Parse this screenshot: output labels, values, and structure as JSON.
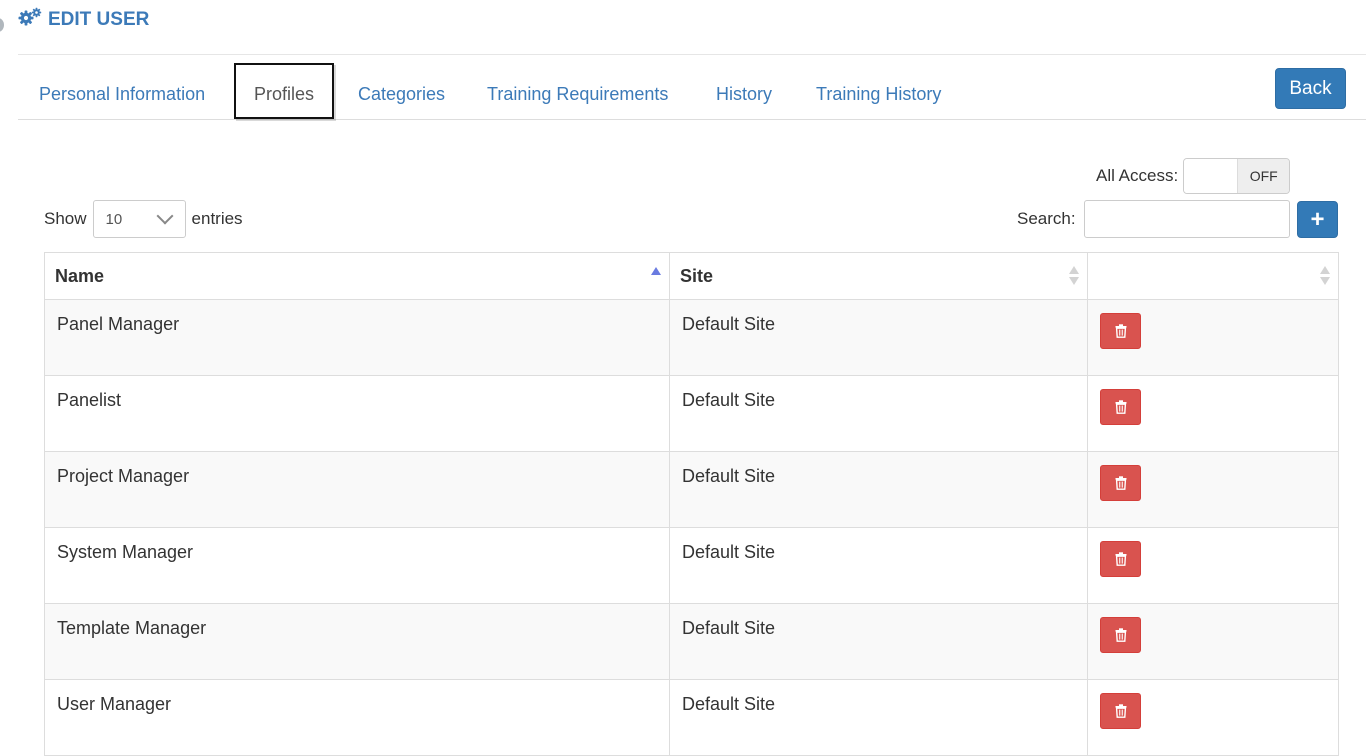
{
  "header": {
    "title": "EDIT USER",
    "icon": "gears-icon"
  },
  "tabs": [
    {
      "label": "Personal Information",
      "active": false
    },
    {
      "label": "Profiles",
      "active": true
    },
    {
      "label": "Categories",
      "active": false
    },
    {
      "label": "Training Requirements",
      "active": false
    },
    {
      "label": "History",
      "active": false
    },
    {
      "label": "Training History",
      "active": false
    }
  ],
  "back_label": "Back",
  "all_access": {
    "label": "All Access:",
    "state": "OFF"
  },
  "length": {
    "show": "Show",
    "value": "10",
    "entries": "entries"
  },
  "search": {
    "label": "Search:",
    "value": ""
  },
  "add_label": "+",
  "table": {
    "columns": [
      "Name",
      "Site",
      ""
    ],
    "rows": [
      {
        "name": "Panel Manager",
        "site": "Default Site"
      },
      {
        "name": "Panelist",
        "site": "Default Site"
      },
      {
        "name": "Project Manager",
        "site": "Default Site"
      },
      {
        "name": "System Manager",
        "site": "Default Site"
      },
      {
        "name": "Template Manager",
        "site": "Default Site"
      },
      {
        "name": "User Manager",
        "site": "Default Site"
      }
    ]
  },
  "colors": {
    "accent": "#337ab7",
    "link": "#3c7ab8",
    "danger": "#d9534f"
  }
}
